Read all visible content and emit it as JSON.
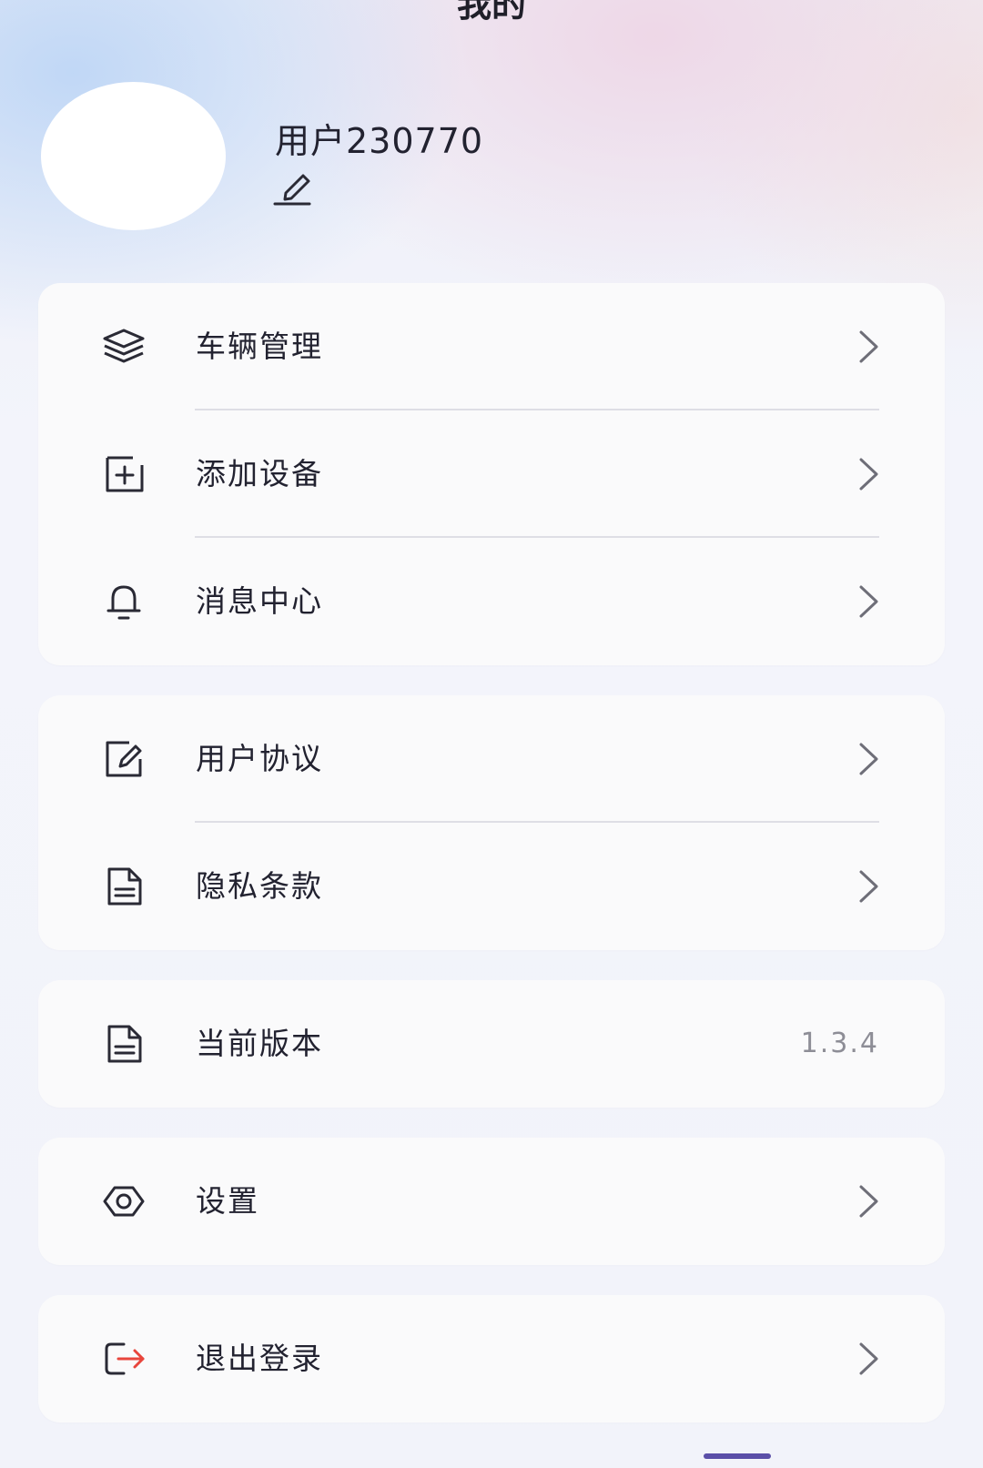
{
  "header": {
    "title": "我的"
  },
  "profile": {
    "username": "用户230770"
  },
  "groups": [
    {
      "items": [
        {
          "label": "车辆管理",
          "icon": "layers-icon"
        },
        {
          "label": "添加设备",
          "icon": "add-box-icon"
        },
        {
          "label": "消息中心",
          "icon": "bell-icon"
        }
      ]
    },
    {
      "items": [
        {
          "label": "用户协议",
          "icon": "agreement-icon"
        },
        {
          "label": "隐私条款",
          "icon": "document-icon"
        }
      ]
    },
    {
      "items": [
        {
          "label": "当前版本",
          "icon": "document-icon",
          "value": "1.3.4"
        }
      ]
    },
    {
      "items": [
        {
          "label": "设置",
          "icon": "settings-icon"
        }
      ]
    },
    {
      "items": [
        {
          "label": "退出登录",
          "icon": "logout-icon"
        }
      ]
    }
  ],
  "colors": {
    "accent": "#e8453c",
    "text": "#222230",
    "muted": "#8d8d96",
    "indicator": "#5b4fa8"
  }
}
